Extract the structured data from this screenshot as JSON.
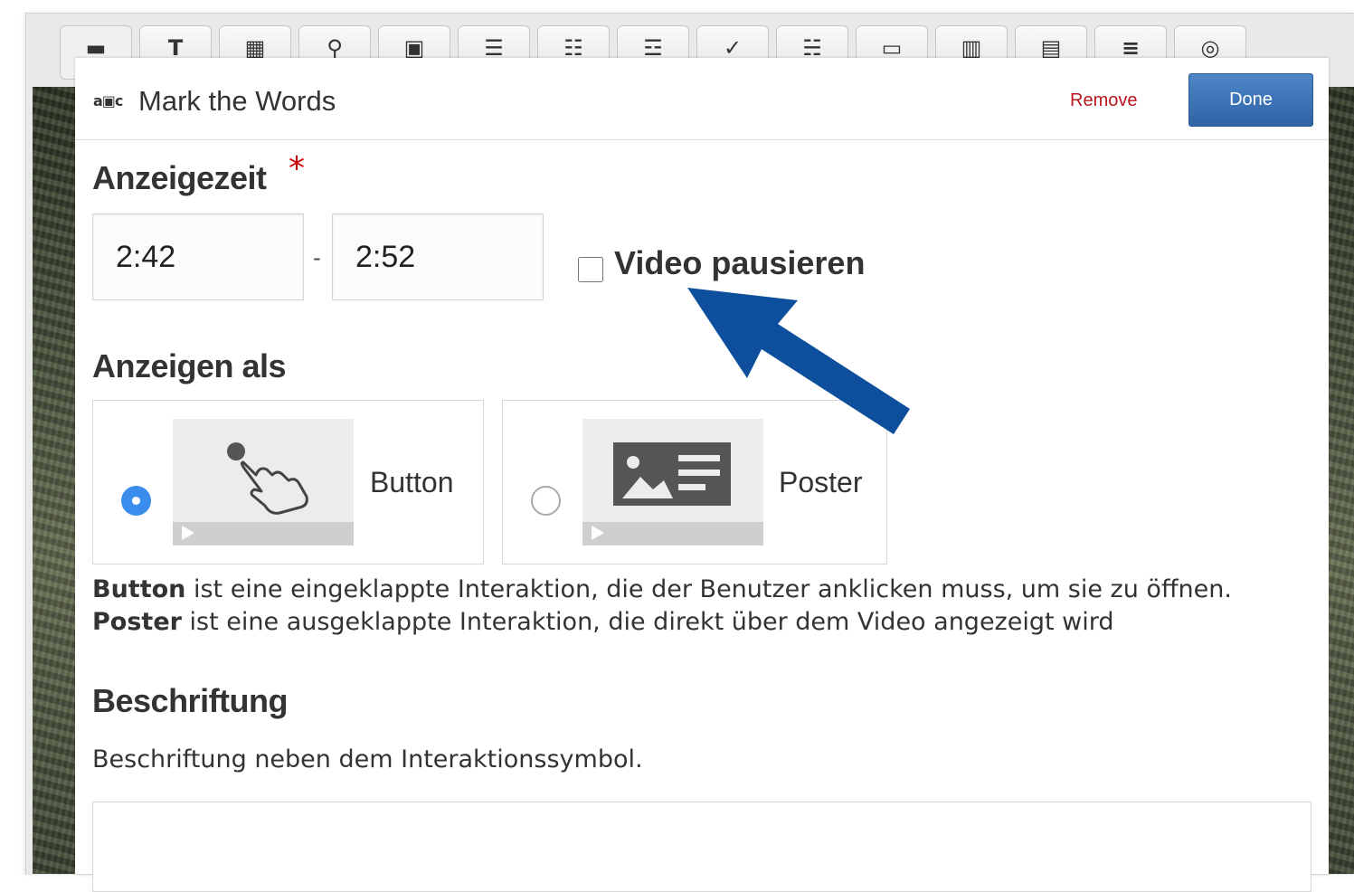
{
  "toolbar": {
    "buttons": [
      {
        "name": "toolbar-handle-icon",
        "glyph": "▬"
      },
      {
        "name": "text-tool-icon",
        "glyph": "T"
      },
      {
        "name": "table-tool-icon",
        "glyph": "▦"
      },
      {
        "name": "link-tool-icon",
        "glyph": "⚲"
      },
      {
        "name": "image-tool-icon",
        "glyph": "▣"
      },
      {
        "name": "list-tool-icon",
        "glyph": "☰"
      },
      {
        "name": "single-choice-tool-icon",
        "glyph": "☷"
      },
      {
        "name": "multiple-choice-tool-icon",
        "glyph": "☲"
      },
      {
        "name": "true-false-tool-icon",
        "glyph": "✓"
      },
      {
        "name": "drag-drop-tool-icon",
        "glyph": "☵"
      },
      {
        "name": "navigation-hotspot-tool-icon",
        "glyph": "▭"
      },
      {
        "name": "mark-words-tool-icon",
        "glyph": "▥"
      },
      {
        "name": "fill-blanks-tool-icon",
        "glyph": "▤"
      },
      {
        "name": "summary-tool-icon",
        "glyph": "≡"
      },
      {
        "name": "crossroads-tool-icon",
        "glyph": "◎"
      }
    ]
  },
  "dialog": {
    "icon": "a▣c",
    "title": "Mark the Words",
    "remove_label": "Remove",
    "done_label": "Done"
  },
  "display_time": {
    "heading": "Anzeigezeit",
    "required_mark": "*",
    "start": "2:42",
    "separator": "-",
    "end": "2:52",
    "pause_label": "Video pausieren",
    "pause_checked": false
  },
  "display_as": {
    "heading": "Anzeigen als",
    "options": [
      {
        "label": "Button",
        "selected": true
      },
      {
        "label": "Poster",
        "selected": false
      }
    ],
    "description": {
      "line1_bold": "Button",
      "line1_rest": " ist eine eingeklappte Interaktion, die der Benutzer anklicken muss, um sie zu öffnen.",
      "line2_bold": "Poster",
      "line2_rest": " ist eine ausgeklappte Interaktion, die direkt über dem Video angezeigt wird"
    }
  },
  "caption": {
    "heading": "Beschriftung",
    "description": "Beschriftung neben dem Interaktionssymbol.",
    "value": ""
  },
  "colors": {
    "arrow": "#0d4f9c",
    "done_button": "#3a72b5",
    "remove_link": "#b9161d",
    "radio_selected": "#3b8ded"
  }
}
